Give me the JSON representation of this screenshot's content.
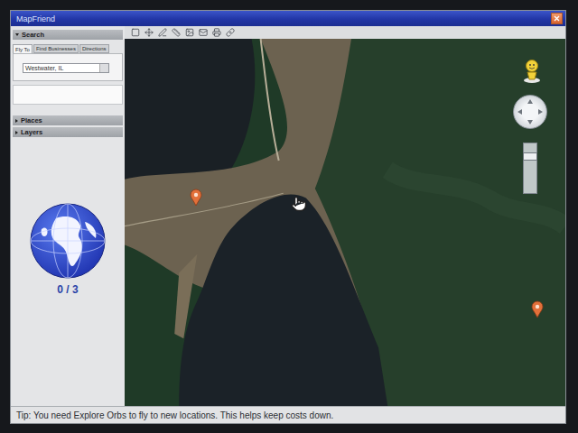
{
  "window": {
    "title": "MapFriend"
  },
  "search": {
    "header": "Search",
    "expanded": true,
    "tabs": [
      {
        "label": "Fly To",
        "selected": true
      },
      {
        "label": "Find Businesses",
        "selected": false
      },
      {
        "label": "Directions",
        "selected": false
      }
    ],
    "input": "Westwater, IL"
  },
  "sections": [
    {
      "label": "Places",
      "expanded": false
    },
    {
      "label": "Layers",
      "expanded": false
    }
  ],
  "orbs": {
    "count": "0 / 3"
  },
  "map": {
    "zoom": {
      "level": 0.8
    }
  },
  "status_bar": {
    "tip": "Tip: You need Explore Orbs to fly to new locations. This helps keep costs down."
  }
}
